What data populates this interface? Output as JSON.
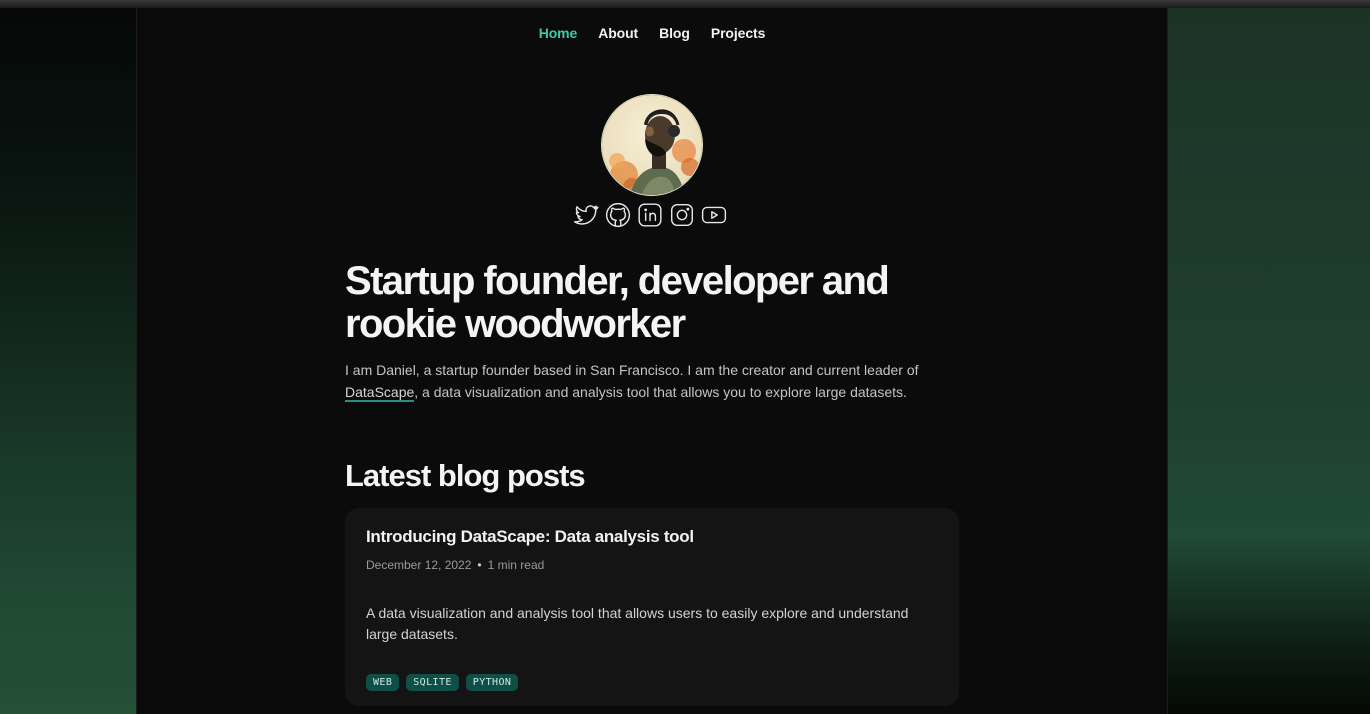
{
  "nav": {
    "items": [
      {
        "label": "Home",
        "active": true
      },
      {
        "label": "About",
        "active": false
      },
      {
        "label": "Blog",
        "active": false
      },
      {
        "label": "Projects",
        "active": false
      }
    ]
  },
  "profile": {
    "avatar_icon": "illustrated-portrait-avatar",
    "socials": [
      "twitter-icon",
      "github-icon",
      "linkedin-icon",
      "instagram-icon",
      "youtube-icon"
    ]
  },
  "hero": {
    "title": "Startup founder, developer and rookie woodworker",
    "text_before_link": "I am Daniel, a startup founder based in San Francisco. I am the creator and current leader of ",
    "link_text": "DataScape",
    "text_after_link": ", a data visualization and analysis tool that allows you to explore large datasets."
  },
  "blog": {
    "section_title": "Latest blog posts",
    "posts": [
      {
        "title": "Introducing DataScape: Data analysis tool",
        "date": "December 12, 2022",
        "separator": "•",
        "read_time": "1 min read",
        "description": "A data visualization and analysis tool that allows users to easily explore and understand large datasets.",
        "tags": [
          "WEB",
          "SQLITE",
          "PYTHON"
        ]
      }
    ]
  },
  "colors": {
    "accent": "#3fc7ad",
    "tag_bg": "#0f4f47",
    "background": "#0b0b0b",
    "card_bg": "#141414"
  }
}
